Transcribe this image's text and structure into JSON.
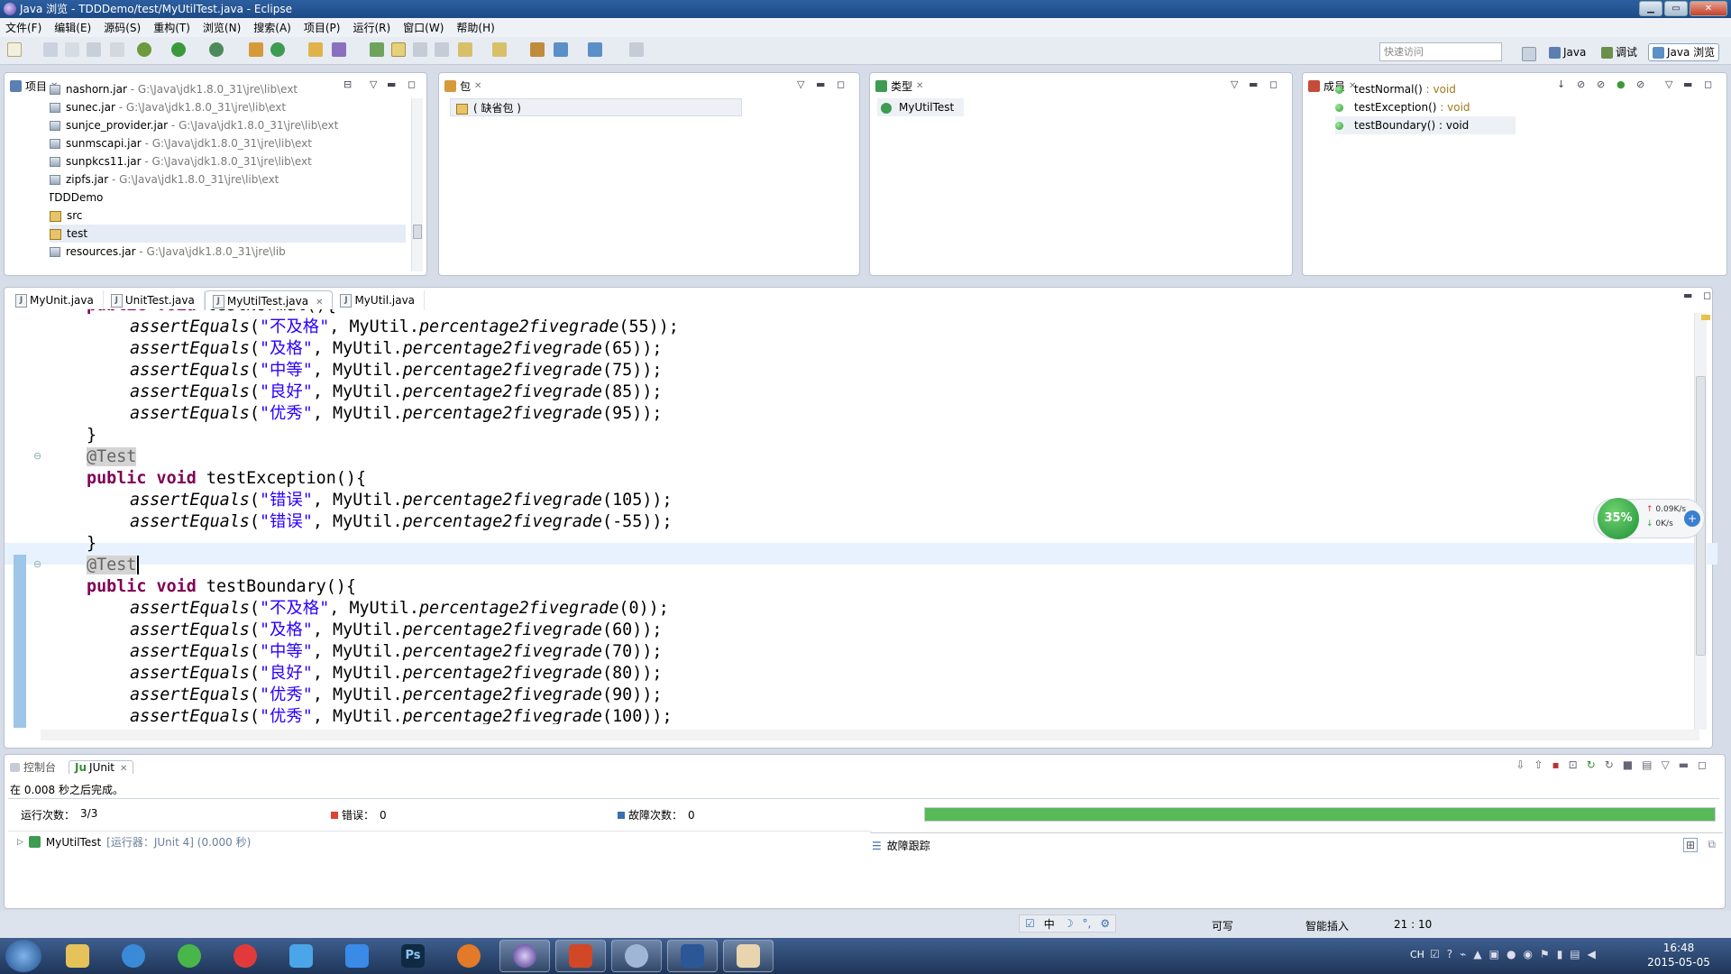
{
  "window": {
    "title": "Java 浏览 - TDDDemo/test/MyUtilTest.java - Eclipse"
  },
  "menu": [
    "文件(F)",
    "编辑(E)",
    "源码(S)",
    "重构(T)",
    "浏览(N)",
    "搜索(A)",
    "项目(P)",
    "运行(R)",
    "窗口(W)",
    "帮助(H)"
  ],
  "toolbar": {
    "quick_access_placeholder": "快速访问",
    "perspective_java": "Java",
    "perspective_debug": "调试",
    "perspective_java_browse": "Java 浏览"
  },
  "projects": {
    "tab": "项目",
    "items": [
      {
        "name": "nashorn.jar",
        "path": " - G:\\Java\\jdk1.8.0_31\\jre\\lib\\ext"
      },
      {
        "name": "sunec.jar",
        "path": " - G:\\Java\\jdk1.8.0_31\\jre\\lib\\ext"
      },
      {
        "name": "sunjce_provider.jar",
        "path": " - G:\\Java\\jdk1.8.0_31\\jre\\lib\\ext"
      },
      {
        "name": "sunmscapi.jar",
        "path": " - G:\\Java\\jdk1.8.0_31\\jre\\lib\\ext"
      },
      {
        "name": "sunpkcs11.jar",
        "path": " - G:\\Java\\jdk1.8.0_31\\jre\\lib\\ext"
      },
      {
        "name": "zipfs.jar",
        "path": " - G:\\Java\\jdk1.8.0_31\\jre\\lib\\ext"
      },
      {
        "name": "TDDDemo",
        "path": ""
      },
      {
        "name": "src",
        "path": ""
      },
      {
        "name": "test",
        "path": ""
      },
      {
        "name": "resources.jar",
        "path": " - G:\\Java\\jdk1.8.0_31\\jre\\lib"
      }
    ]
  },
  "packages": {
    "tab": "包",
    "item": "( 缺省包 )"
  },
  "types": {
    "tab": "类型",
    "item": "MyUtilTest"
  },
  "members": {
    "tab": "成员",
    "items": [
      {
        "name": "testNormal()",
        "type": " : void"
      },
      {
        "name": "testException()",
        "type": " : void"
      },
      {
        "name": "testBoundary()",
        "type": " : void"
      }
    ]
  },
  "editor_tabs": [
    "MyUnit.java",
    "UnitTest.java",
    "MyUtilTest.java",
    "MyUtil.java"
  ],
  "code": {
    "l0": "public void testNormal(){",
    "n55": "55",
    "n65": "65",
    "n75": "75",
    "n85": "85",
    "n95": "95",
    "e105": "105",
    "en55": "-55",
    "b0": "0",
    "b60": "60",
    "b70": "70",
    "b80": "80",
    "b90": "90",
    "b100": "100",
    "assert": "assertEquals",
    "method": "percentage2fivegrade",
    "cls": "MyUtil",
    "g_fail": "\"不及格\"",
    "g_pass": "\"及格\"",
    "g_mid": "\"中等\"",
    "g_good": "\"良好\"",
    "g_exc": "\"优秀\"",
    "g_err": "\"错误\"",
    "annotation": "@Test",
    "kw": "public void",
    "m_exception": " testException(){",
    "m_boundary": " testBoundary(){",
    "close": "}"
  },
  "netmon": {
    "percent": "35%",
    "up": "0.09K/s",
    "down": "0K/s"
  },
  "junit": {
    "tab_console": "控制台",
    "tab_junit": "JUnit",
    "finished": "在 0.008 秒之后完成。",
    "runs_label": "运行次数：",
    "runs_value": "3/3",
    "errors_label": "错误：",
    "errors_value": "0",
    "failures_label": "故障次数：",
    "failures_value": "0",
    "progress": 1.0,
    "tree_item": "MyUtilTest",
    "tree_runner": "[运行器：JUnit 4] (0.000 秒)",
    "trace_label": "故障跟踪"
  },
  "status": {
    "writable": "可写",
    "insert": "智能插入",
    "position": "21 : 10",
    "ime": "中"
  },
  "taskbar": {
    "time": "16:48",
    "date": "2015-05-05",
    "lang": "CH"
  },
  "colors": {
    "progress": "#58b957",
    "title_bar": "#1e4b86"
  }
}
